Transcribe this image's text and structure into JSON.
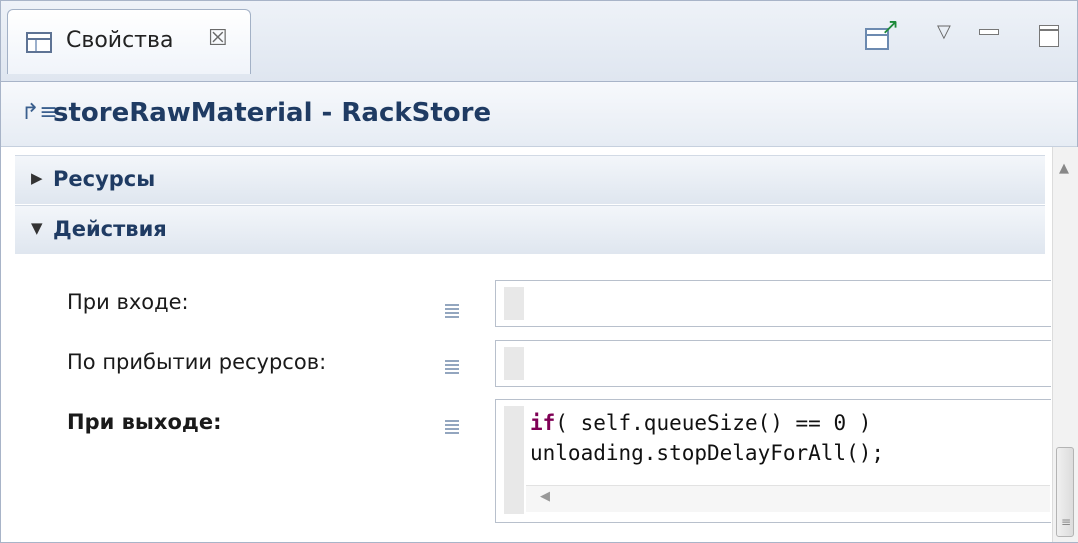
{
  "view_tab": {
    "label": "Свойства",
    "close_glyph": "☒",
    "icon": "properties-table-icon"
  },
  "toolbar": {
    "pin_icon": "pin-to-view-icon",
    "view_menu_glyph": "▽",
    "minimize_icon": "minimize-icon",
    "maximize_icon": "maximize-icon"
  },
  "title": {
    "icon": "rack-store-block-icon",
    "icon_glyph": "↱≡",
    "text": "storeRawMaterial - RackStore"
  },
  "sections": [
    {
      "title": "Ресурсы",
      "expanded": false,
      "arrow_glyph": "▶"
    },
    {
      "title": "Действия",
      "expanded": true,
      "arrow_glyph": "▼"
    }
  ],
  "actions": {
    "on_enter": {
      "label": "При входе:",
      "value": ""
    },
    "on_resources_arrival": {
      "label": "По прибытии ресурсов:",
      "value": ""
    },
    "on_exit": {
      "label": "При выходе:",
      "code_line1_keyword": "if",
      "code_line1_rest": "( self.queueSize() == 0 )",
      "code_line2": "unloading.stopDelayForAll();"
    }
  },
  "scrollbar": {
    "up_glyph": "▲",
    "grip_glyph": "≡",
    "hscroll_left_glyph": "◀"
  },
  "colors": {
    "section_title": "#1f3b63",
    "keyword": "#7f0055",
    "border": "#a8b4c8"
  }
}
